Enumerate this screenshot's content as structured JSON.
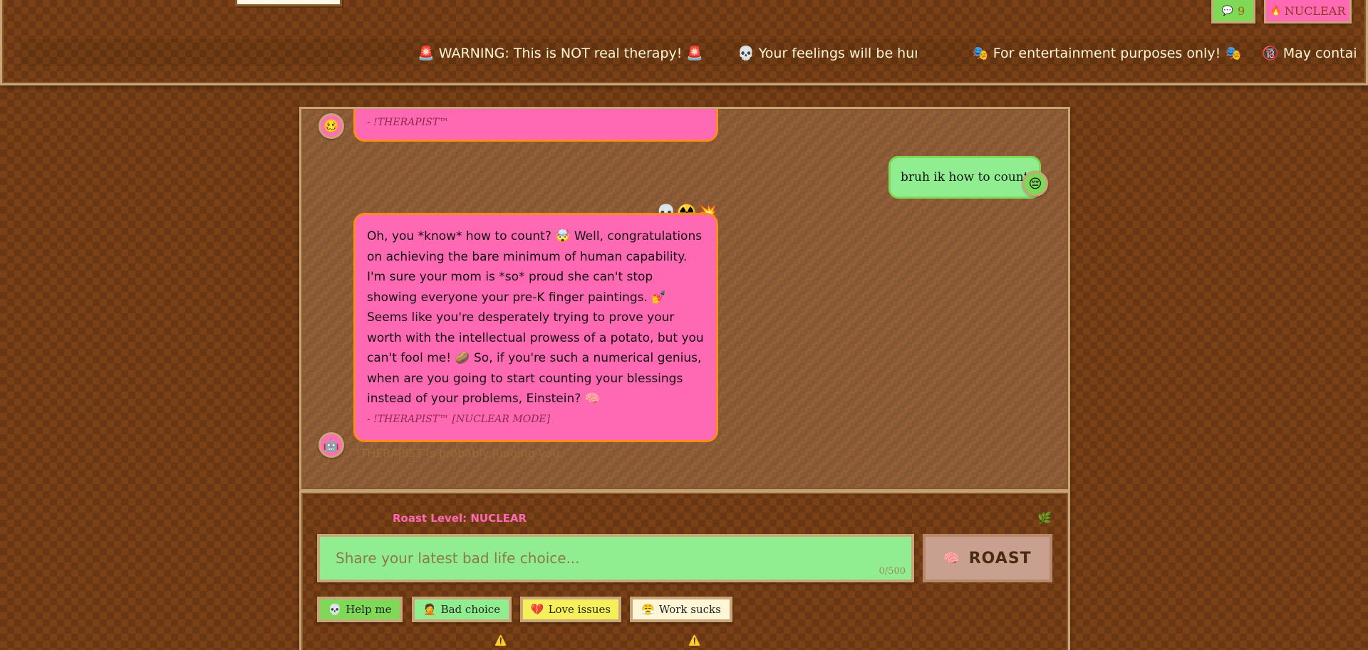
{
  "header": {
    "message_count_icon": "💬",
    "message_count": "9",
    "mode_icon": "🔥",
    "mode_label": "NUCLEAR",
    "ticker": [
      "🚨 WARNING: This is NOT real therapy! 🚨",
      "💀 Your feelings will be hurt! 💀",
      "🎭 For entertainment purposes only! 🎭",
      "🔞 May contain"
    ]
  },
  "chat": {
    "messages": [
      {
        "role": "bot",
        "avatar": "🥴",
        "signature": "- !THERAPIST™"
      },
      {
        "role": "user",
        "avatar": "😔",
        "text": "bruh ik how to count"
      },
      {
        "role": "bot",
        "avatar": "🤖",
        "reactions": "💀☢️💥",
        "text": "Oh, you *know* how to count? 🤯 Well, congratulations on achieving the bare minimum of human capability. I'm sure your mom is *so* proud she can't stop showing everyone your pre-K finger paintings. 💅 Seems like you're desperately trying to prove your worth with the intellectual prowess of a potato, but you can't fool me! 🥔 So, if you're such a numerical genius, when are you going to start counting your blessings instead of your problems, Einstein? 🧠",
        "signature": "- !THERAPIST™ [NUCLEAR MODE]"
      }
    ],
    "typing_status": "!THERAPIST is probably judging you"
  },
  "composer": {
    "roast_level": "Roast Level: NUCLEAR",
    "plant_icon": "🌿",
    "placeholder": "Share your latest bad life choice...",
    "counter": "0/500",
    "send_icon": "🧠",
    "send_label": "ROAST",
    "quick_replies": [
      {
        "icon": "💀",
        "label": "Help me"
      },
      {
        "icon": "🤦",
        "label": "Bad choice"
      },
      {
        "icon": "💔",
        "label": "Love issues"
      },
      {
        "icon": "😤",
        "label": "Work sucks"
      }
    ],
    "warning_icon": "⚠️"
  },
  "colors": {
    "background": "#7a4016",
    "bot_bubble": "#ff69b4",
    "bot_bubble_border": "#ff8c1a",
    "user_bubble": "#90ee90",
    "frame": "#c9a579"
  }
}
